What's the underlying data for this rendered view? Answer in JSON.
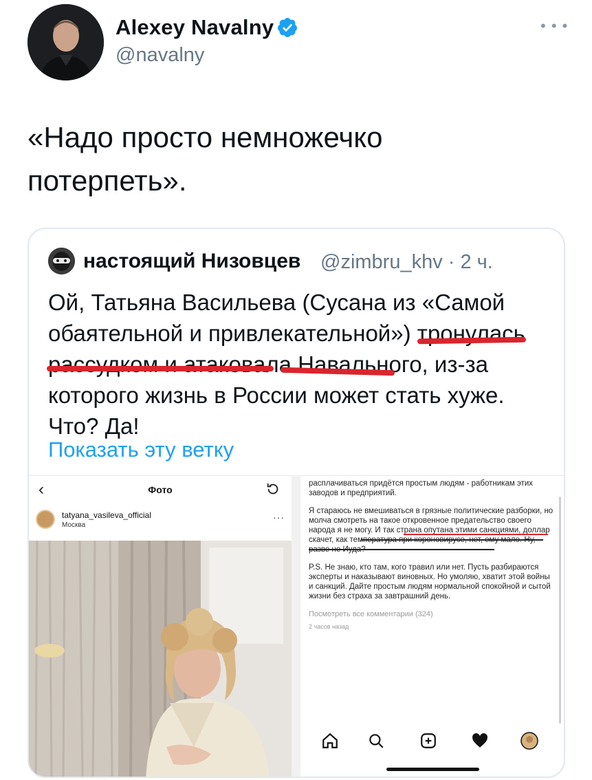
{
  "tweet": {
    "author_name": "Alexey Navalny",
    "author_handle": "@navalny",
    "text": "«Надо просто немножечко\nпотерпеть».",
    "more_icon": "more-horizontal-icon",
    "verified_icon": "verified-badge-icon"
  },
  "quote": {
    "author_name": "настоящий Низовцев",
    "author_handle": "@zimbru_khv · 2 ч.",
    "text": "Ой, Татьяна Васильева (Сусана из «Самой обаятельной и привлекательной») тронулась рассудком и атаковала Навального, из-за которого жизнь в России может стать хуже. Что? Да!",
    "show_thread": "Показать эту ветку"
  },
  "instagram_left": {
    "title": "Фото",
    "username": "tatyana_vasileva_official",
    "location": "Москва"
  },
  "instagram_right": {
    "para1": "расплачиваться придётся простым людям - работникам этих заводов и предприятий.",
    "para2": "Я стараюсь не вмешиваться в грязные политические разборки, но молча смотреть на такое откровенное предательство своего народа я не могу. И так страна опутана этими санкциями, доллар скачет, как температура при короновирусе, нет, ему мало. Ну, разве не Иуда?",
    "para3": "P.S. Не знаю, кто там, кого травил или нет. Пусть разбираются эксперты и наказывают виновных. Но умоляю, хватит этой войны и санкций. Дайте простым людям нормальной спокойной и сытой жизни без страха за завтрашний день.",
    "view_comments": "Посмотреть все комментарии (324)",
    "time_ago": "2 часов назад",
    "nav_icons": [
      "home-icon",
      "search-icon",
      "add-post-icon",
      "heart-icon",
      "profile-avatar-icon"
    ]
  },
  "colors": {
    "link": "#1da1f2",
    "verified": "#1da1f2",
    "underline": "#d9252e",
    "secondary_text": "#657786"
  }
}
